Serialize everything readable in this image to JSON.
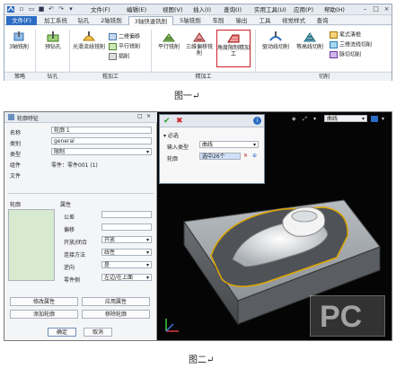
{
  "fig1": {
    "caption": "图一↵",
    "menus": [
      "文件(F)",
      "编辑(E)",
      "视图(V)",
      "插入(I)",
      "查询(I)",
      "实用工具(U)",
      "应用(P)",
      "帮助(H)"
    ],
    "window_controls": [
      "–",
      "□",
      "×"
    ],
    "tabs": [
      "文件(F)",
      "加工系统",
      "钻孔",
      "2轴铣削",
      "3轴快速铣削",
      "5轴铣削",
      "车削",
      "输出",
      "工具",
      "视觉样式",
      "查询"
    ],
    "buttons": {
      "mill3": "3轴铣削",
      "predrill": "预钻孔",
      "flowline": "光滑流线铣削",
      "two_offset": "二维偏移",
      "parallel": "平行铣削",
      "plunge": "插削",
      "parallel2": "平行铣削",
      "offset3d": "三维偏移铣削",
      "angle_finish": "角度限制精加工",
      "drive": "驱动线切削",
      "zlevel": "等高线切削",
      "pencil": "笔式清根",
      "spiral3d": "三维流线切削",
      "pin_cut": "脉切切削"
    },
    "groups": [
      "策略",
      "钻孔",
      "粗加工",
      "精加工",
      "切削"
    ]
  },
  "fig2": {
    "caption": "图二↵",
    "panel_title": "轮廓特征",
    "fields": [
      {
        "label": "名称",
        "value": "轮廓 1"
      },
      {
        "label": "类别",
        "value": "general"
      },
      {
        "label": "类型",
        "value": "限制"
      },
      {
        "label": "组件",
        "value": "零件：零件001 (1)"
      },
      {
        "label": "文件",
        "value": ""
      }
    ],
    "list_label": "轮廓",
    "attr_header": "属性",
    "attrs": [
      {
        "label": "公差",
        "value": ""
      },
      {
        "label": "偏移",
        "value": ""
      },
      {
        "label": "开放/闭合",
        "value": "开放"
      },
      {
        "label": "连接方法",
        "value": "线性"
      },
      {
        "label": "逆向",
        "value": "是"
      },
      {
        "label": "零件侧",
        "value": "左边/在上面"
      }
    ],
    "buttons": [
      "修改属性",
      "应用属性",
      "添加轮廓",
      "移除轮廓"
    ],
    "ok": "确定",
    "cancel": "取消",
    "sub_section": "必选",
    "input_type_label": "输入类型",
    "input_type_value": "曲线",
    "contour_label": "轮廓",
    "contour_value": "选中26个",
    "view_filter": "曲线",
    "watermark": "PC"
  }
}
